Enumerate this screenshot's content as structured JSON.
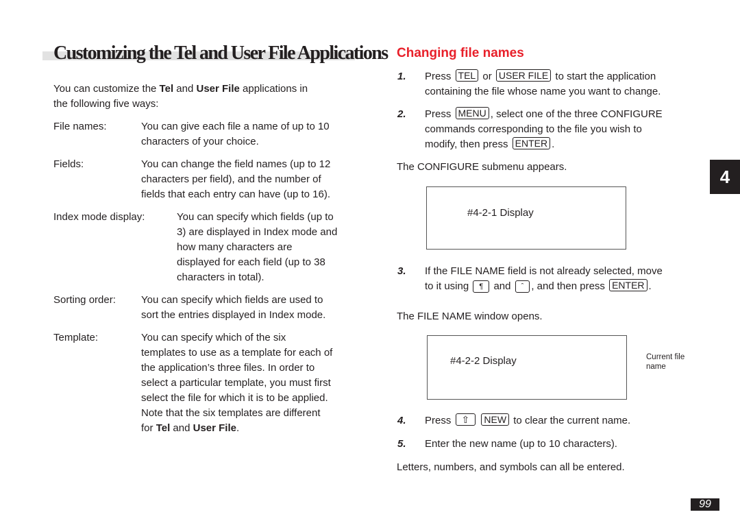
{
  "left": {
    "title": "Customizing the Tel and User File Applications",
    "intro": {
      "p1": "You can customize the ",
      "b1": "Tel",
      "p2": " and ",
      "b2": "User File",
      "p3": " applications in",
      "line2": "the following five ways:"
    },
    "items": [
      {
        "term": "File names:",
        "lines": [
          "You can give each file a name of up to 10",
          "characters of your choice."
        ]
      },
      {
        "term": "Fields:",
        "lines": [
          "You can change the field names (up to 12",
          "characters per field), and the number of",
          "fields that each entry can have (up to 16)."
        ]
      },
      {
        "term": "Index mode display:",
        "lines": [
          "You can specify which fields (up to",
          "3) are displayed in Index mode and",
          "how many characters are",
          "displayed for each field (up to 38",
          "characters in total)."
        ]
      },
      {
        "term": "Sorting order:",
        "lines": [
          "You can specify which fields are used to",
          "sort the entries displayed in Index mode."
        ]
      },
      {
        "term": "Template:",
        "lines": [
          "You can specify which of the six",
          "templates to use as a template for each of",
          "the application’s three files. In order to",
          "select a particular template, you must first",
          "select the file for which it is to be applied.",
          "Note that the six templates are different"
        ],
        "last": {
          "p1": "for ",
          "b1": "Tel",
          "p2": " and ",
          "b2": "User File",
          "p3": "."
        }
      }
    ]
  },
  "right": {
    "heading": "Changing file names",
    "heading_color": "#e8202a",
    "steps": [
      {
        "num": "1.",
        "a": "Press ",
        "k1": "TEL",
        "b": " or ",
        "k2": "USER FILE",
        "c": " to start the application",
        "line2": "containing the file whose name you want to change."
      },
      {
        "num": "2.",
        "a": "Press ",
        "k1": "MENU",
        "b": ", select one of the three CONFIGURE",
        "line2": "commands corresponding to the file you wish to",
        "line3a": "modify, then press ",
        "k2": "ENTER",
        "line3b": "."
      },
      {
        "num": "3.",
        "line1": "If the FILE NAME field is not already selected, move",
        "a": "to it using ",
        "k1": "¶",
        "b": " and ",
        "k2": "ˆ",
        "c": ", and then press ",
        "k3": "ENTER",
        "d": "."
      },
      {
        "num": "4.",
        "a": "Press ",
        "k1": "⇧",
        "k2": "NEW",
        "c": " to clear the current name."
      },
      {
        "num": "5.",
        "text": "Enter the new name (up to 10 characters)."
      }
    ],
    "configure_note": "The CONFIGURE submenu appears.",
    "display1": "#4-2-1 Display",
    "filename_note": "The FILE NAME window opens.",
    "display2": "#4-2-2 Display",
    "callout": [
      "Current file",
      "name"
    ],
    "final_note": "Letters, numbers, and symbols can all be entered."
  },
  "chapter_tab": "4",
  "page_number": "99"
}
